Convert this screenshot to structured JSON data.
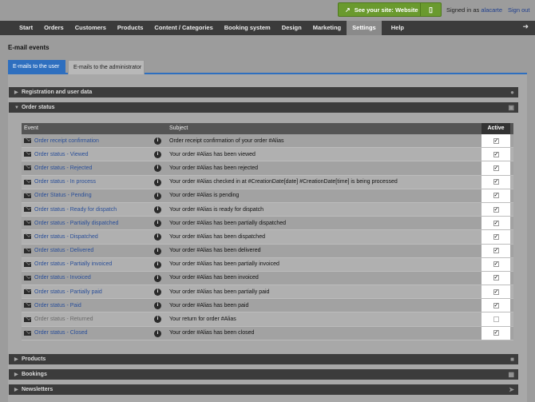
{
  "topbar": {
    "site_button": "See your site: Website",
    "signed_in_prefix": "Signed in as",
    "user": "alacarte",
    "sign_out": "Sign out"
  },
  "nav": {
    "items": [
      "Start",
      "Orders",
      "Customers",
      "Products",
      "Content / Categories",
      "Booking system",
      "Design",
      "Marketing",
      "Settings",
      "Help"
    ],
    "active": "Settings"
  },
  "page_title": "E-mail events",
  "tabs": [
    {
      "label": "E-mails to the user",
      "active": true
    },
    {
      "label": "E-mails to the administrator",
      "active": false
    }
  ],
  "sections": {
    "registration": "Registration and user data",
    "order_status": "Order status",
    "products": "Products",
    "bookings": "Bookings",
    "newsletters": "Newsletters"
  },
  "table": {
    "headers": {
      "event": "Event",
      "subject": "Subject",
      "active": "Active"
    },
    "rows": [
      {
        "event": "Order receipt confirmation",
        "subject": "Order receipt confirmation of your order #Alias",
        "active": true
      },
      {
        "event": "Order status - Viewed",
        "subject": "Your order #Alias has been viewed",
        "active": true
      },
      {
        "event": "Order status - Rejected",
        "subject": "Your order #Alias has been rejected",
        "active": true
      },
      {
        "event": "Order status - In process",
        "subject": "Your order #Alias checked in at #CreationDate[date] #CreationDate[time] is being processed",
        "active": true
      },
      {
        "event": "Order Status - Pending",
        "subject": "Your order #Alias is pending",
        "active": true
      },
      {
        "event": "Order status - Ready for dispatch",
        "subject": "Your order #Alias is ready for dispatch",
        "active": true
      },
      {
        "event": "Order status - Partially dispatched",
        "subject": "Your order #Alias has been partially dispatched",
        "active": true
      },
      {
        "event": "Order status - Dispatched",
        "subject": "Your order #Alias has been dispatched",
        "active": true
      },
      {
        "event": "Order status - Delivered",
        "subject": "Your order #Alias has been delivered",
        "active": true
      },
      {
        "event": "Order status - Partially invoiced",
        "subject": "Your order #Alias has been partially invoiced",
        "active": true
      },
      {
        "event": "Order status - Invoiced",
        "subject": "Your order #Alias has been invoiced",
        "active": true
      },
      {
        "event": "Order status - Partially paid",
        "subject": "Your order #Alias has been partially paid",
        "active": true
      },
      {
        "event": "Order status - Paid",
        "subject": "Your order #Alias has been paid",
        "active": true
      },
      {
        "event": "Order status - Returned",
        "subject": "Your return for order #Alias",
        "active": false
      },
      {
        "event": "Order status - Closed",
        "subject": "Your order #Alias has been closed",
        "active": true
      }
    ]
  },
  "colors": {
    "accent": "#2e6fbf",
    "site_button": "#6a9a2e",
    "nav_bg": "#3b3b3b"
  }
}
